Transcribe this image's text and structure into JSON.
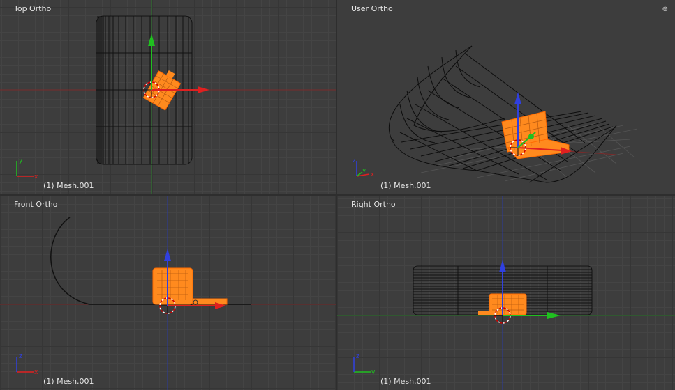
{
  "viewports": {
    "top_left": {
      "title": "Top Ortho",
      "object": "(1) Mesh.001"
    },
    "top_right": {
      "title": "User Ortho",
      "object": "(1) Mesh.001"
    },
    "bottom_left": {
      "title": "Front Ortho",
      "object": "(1) Mesh.001"
    },
    "bottom_right": {
      "title": "Right Ortho",
      "object": "(1) Mesh.001"
    }
  },
  "axis_labels": {
    "x": "x",
    "y": "y",
    "z": "z"
  },
  "colors": {
    "selection": "#ff8a1e",
    "axis_x": "#e02020",
    "axis_y": "#20c020",
    "axis_z": "#3040e0",
    "background": "#3d3d3d"
  },
  "icons": {
    "view_options": "plus-icon"
  }
}
